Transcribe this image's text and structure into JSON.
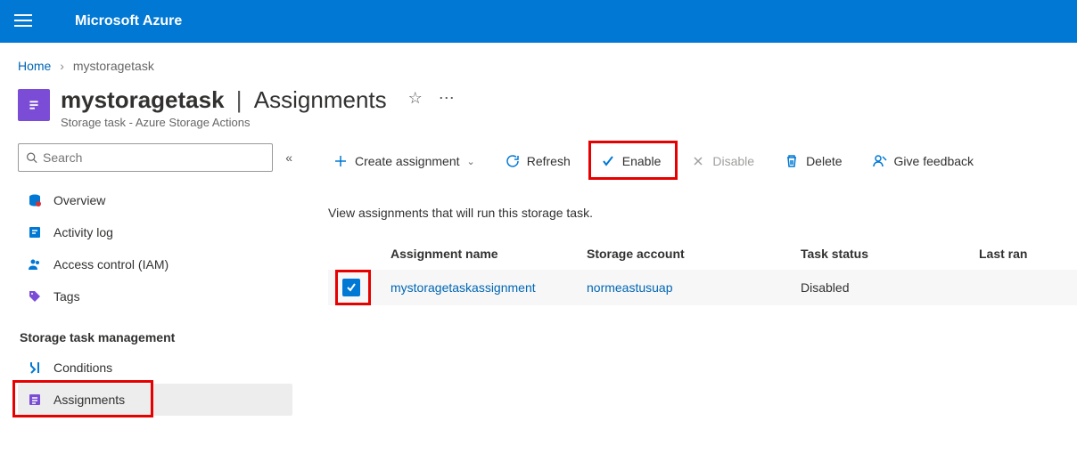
{
  "brand": "Microsoft Azure",
  "breadcrumb": {
    "home": "Home",
    "current": "mystoragetask"
  },
  "header": {
    "title": "mystoragetask",
    "subtitle": "Assignments",
    "subtype": "Storage task - Azure Storage Actions"
  },
  "search": {
    "placeholder": "Search"
  },
  "sidebar": {
    "items": [
      {
        "label": "Overview"
      },
      {
        "label": "Activity log"
      },
      {
        "label": "Access control (IAM)"
      },
      {
        "label": "Tags"
      }
    ],
    "section_title": "Storage task management",
    "management": [
      {
        "label": "Conditions"
      },
      {
        "label": "Assignments"
      }
    ]
  },
  "toolbar": {
    "create": "Create assignment",
    "refresh": "Refresh",
    "enable": "Enable",
    "disable": "Disable",
    "delete": "Delete",
    "feedback": "Give feedback"
  },
  "description": "View assignments that will run this storage task.",
  "table": {
    "headers": {
      "name": "Assignment name",
      "account": "Storage account",
      "status": "Task status",
      "last": "Last ran"
    },
    "rows": [
      {
        "checked": true,
        "name": "mystoragetaskassignment",
        "account": "normeastusuap",
        "status": "Disabled",
        "last": ""
      }
    ]
  }
}
